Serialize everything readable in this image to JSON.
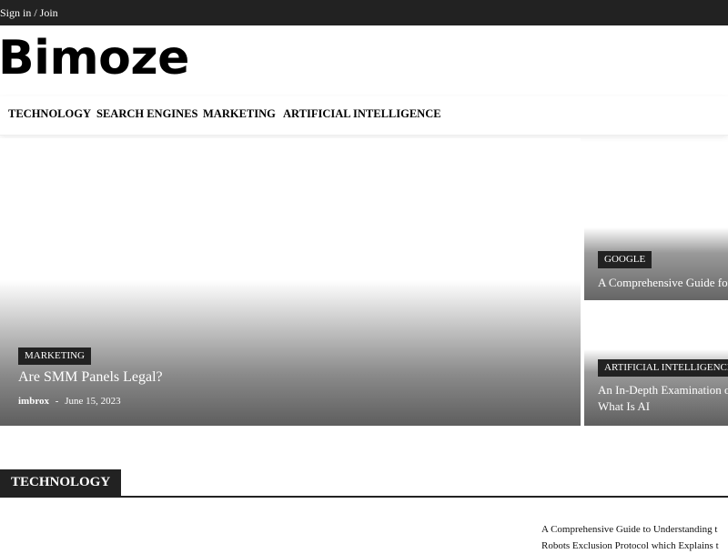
{
  "topbar": {
    "signin": "Sign in / Join"
  },
  "brand": {
    "logo": "Bimoze"
  },
  "nav": [
    {
      "label": "TECHNOLOGY"
    },
    {
      "label": "SEARCH ENGINES"
    },
    {
      "label": "MARKETING"
    },
    {
      "label": "ARTIFICIAL INTELLIGENCE"
    }
  ],
  "featured": {
    "main": {
      "category": "MARKETING",
      "title": "Are SMM Panels Legal?",
      "author": "imbrox",
      "separator": "-",
      "date": "June 15, 2023"
    },
    "side1": {
      "category": "GOOGLE",
      "title": "A Comprehensive Guide for"
    },
    "side2": {
      "category": "ARTIFICIAL INTELLIGENCE",
      "title_line1": "An In-Depth Examination o",
      "title_line2": "What Is AI"
    }
  },
  "section": {
    "title": "TECHNOLOGY"
  },
  "excerpt": {
    "line1": "A Comprehensive Guide to Understanding t",
    "line2": "Robots Exclusion Protocol which Explains t"
  },
  "colors": {
    "dark": "#222222",
    "background": "#ffffff"
  }
}
